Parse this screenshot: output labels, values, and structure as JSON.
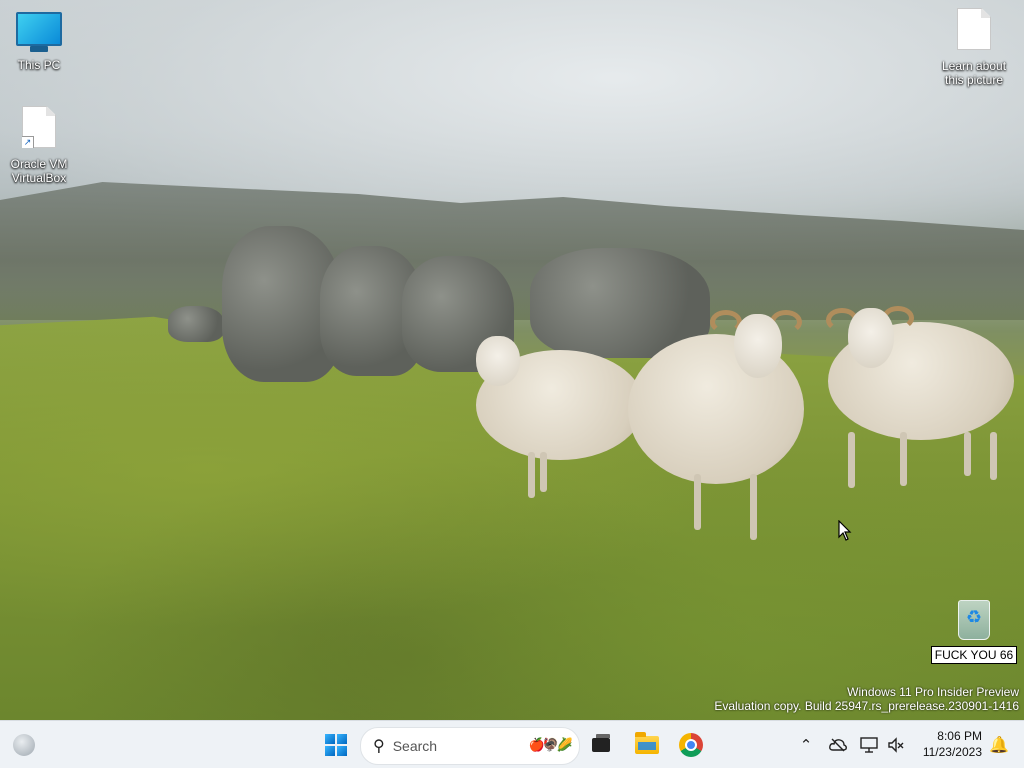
{
  "desktop": {
    "icons": [
      {
        "label": "This PC",
        "icon": "this-pc-icon"
      },
      {
        "label": "Oracle VM VirtualBox",
        "label_line1": "Oracle VM",
        "label_line2": "VirtualBox",
        "icon": "document-shortcut-icon"
      },
      {
        "label": "Learn about this picture",
        "label_line1": "Learn about",
        "label_line2": "this picture",
        "icon": "document-icon"
      },
      {
        "label": "Recycle Bin",
        "icon": "recycle-bin-icon",
        "rename_value": "FUCK YOU 66"
      }
    ],
    "watermark": {
      "line1": "Windows 11 Pro Insider Preview",
      "line2": "Evaluation copy. Build 25947.rs_prerelease.230901-1416"
    }
  },
  "taskbar": {
    "search": {
      "placeholder": "Search"
    },
    "pinned": [
      "Task View",
      "File Explorer",
      "Google Chrome"
    ],
    "tray": {
      "icons": [
        "chevron-up-icon",
        "onedrive-offline-icon",
        "network-icon",
        "volume-muted-icon"
      ]
    },
    "clock": {
      "time": "8:06 PM",
      "date": "11/23/2023"
    }
  },
  "colors": {
    "taskbar_bg": "#eef2f6",
    "accent": "#0067c0"
  }
}
